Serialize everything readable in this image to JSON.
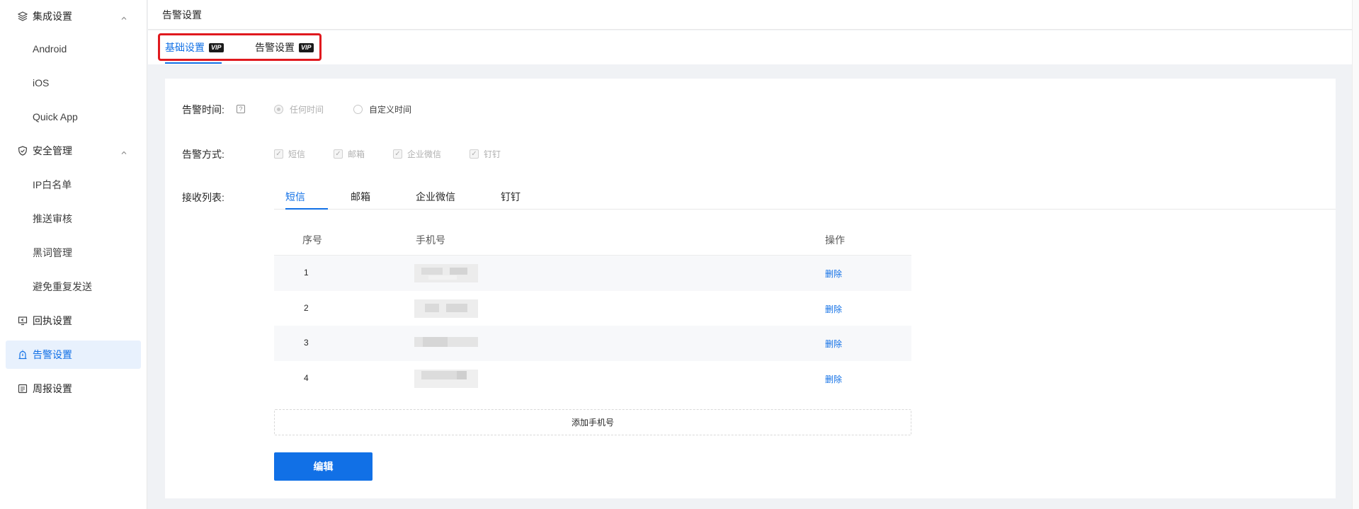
{
  "sidebar": {
    "groups": [
      {
        "label": "集成设置",
        "icon": "layers-icon",
        "expanded": true,
        "items": [
          "Android",
          "iOS",
          "Quick App"
        ]
      },
      {
        "label": "安全管理",
        "icon": "shield-icon",
        "expanded": true,
        "items": [
          "IP白名单",
          "推送审核",
          "黑词管理",
          "避免重复发送"
        ]
      },
      {
        "label": "回执设置",
        "icon": "receipt-icon"
      },
      {
        "label": "告警设置",
        "icon": "alarm-icon",
        "active": true
      },
      {
        "label": "周报设置",
        "icon": "report-icon"
      }
    ]
  },
  "header": {
    "title": "告警设置"
  },
  "tabs": [
    {
      "label": "基础设置",
      "badge": "VIP",
      "active": true
    },
    {
      "label": "告警设置",
      "badge": "VIP",
      "active": false
    }
  ],
  "form": {
    "alarm_time": {
      "label": "告警时间:",
      "help_icon": "?",
      "options": [
        {
          "label": "任何时间",
          "selected": true,
          "disabled": true
        },
        {
          "label": "自定义时间",
          "selected": false,
          "disabled": false
        }
      ]
    },
    "alarm_method": {
      "label": "告警方式:",
      "options": [
        {
          "label": "短信",
          "checked": true
        },
        {
          "label": "邮箱",
          "checked": true
        },
        {
          "label": "企业微信",
          "checked": true
        },
        {
          "label": "钉钉",
          "checked": true
        }
      ]
    },
    "receivers": {
      "label": "接收列表:",
      "tabs": [
        "短信",
        "邮箱",
        "企业微信",
        "钉钉"
      ],
      "active_tab": "短信"
    }
  },
  "table": {
    "headers": [
      "序号",
      "手机号",
      "操作"
    ],
    "rows": [
      {
        "index": "1",
        "action": "删除"
      },
      {
        "index": "2",
        "action": "删除"
      },
      {
        "index": "3",
        "action": "删除"
      },
      {
        "index": "4",
        "action": "删除"
      }
    ]
  },
  "buttons": {
    "add_phone": "添加手机号",
    "edit": "编辑"
  },
  "colors": {
    "accent": "#1170e6",
    "highlight_border": "#e0191e",
    "active_menu_bg": "#e8f1fd"
  }
}
